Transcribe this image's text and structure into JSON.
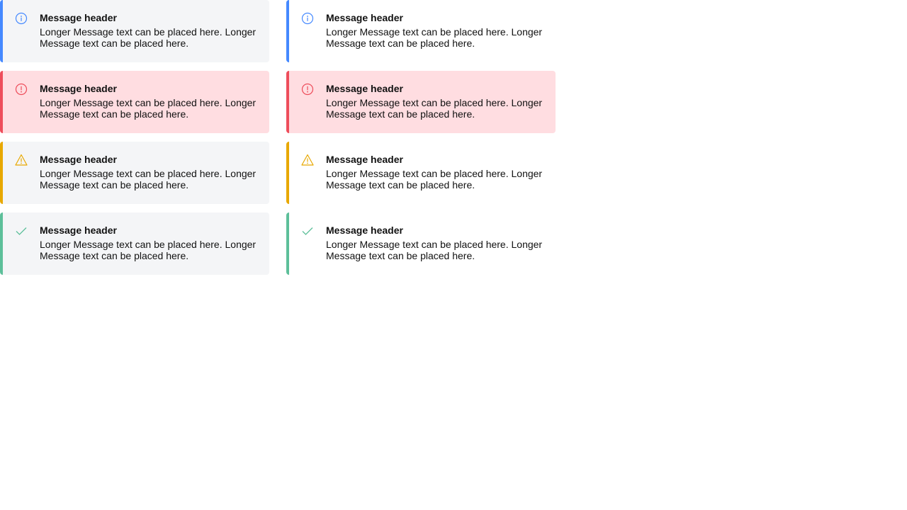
{
  "colors": {
    "info": "#4589ff",
    "error": "#ee4d5b",
    "warning": "#e8a800",
    "success": "#5dbf9a",
    "filled_background": "#f4f5f7",
    "error_background": "#ffdde1"
  },
  "filled_column": {
    "messages": [
      {
        "kind": "info",
        "icon": "info-circle-icon",
        "header": "Message header",
        "body": "Longer Message text can be placed here. Longer Message text can be placed here."
      },
      {
        "kind": "error",
        "icon": "exclamation-circle-icon",
        "header": "Message header",
        "body": "Longer Message text can be placed here. Longer Message text can be placed here."
      },
      {
        "kind": "warning",
        "icon": "warning-triangle-icon",
        "header": "Message header",
        "body": "Longer Message text can be placed here. Longer Message text can be placed here."
      },
      {
        "kind": "success",
        "icon": "checkmark-icon",
        "header": "Message header",
        "body": "Longer Message text can be placed here. Longer Message text can be placed here."
      }
    ]
  },
  "outlined_column": {
    "messages": [
      {
        "kind": "info",
        "icon": "info-circle-icon",
        "header": "Message header",
        "body": "Longer Message text can be placed here. Longer Message text can be placed here."
      },
      {
        "kind": "error",
        "icon": "exclamation-circle-icon",
        "header": "Message header",
        "body": "Longer Message text can be placed here. Longer Message text can be placed here."
      },
      {
        "kind": "warning",
        "icon": "warning-triangle-icon",
        "header": "Message header",
        "body": "Longer Message text can be placed here. Longer Message text can be placed here."
      },
      {
        "kind": "success",
        "icon": "checkmark-icon",
        "header": "Message header",
        "body": "Longer Message text can be placed here. Longer Message text can be placed here."
      }
    ]
  }
}
